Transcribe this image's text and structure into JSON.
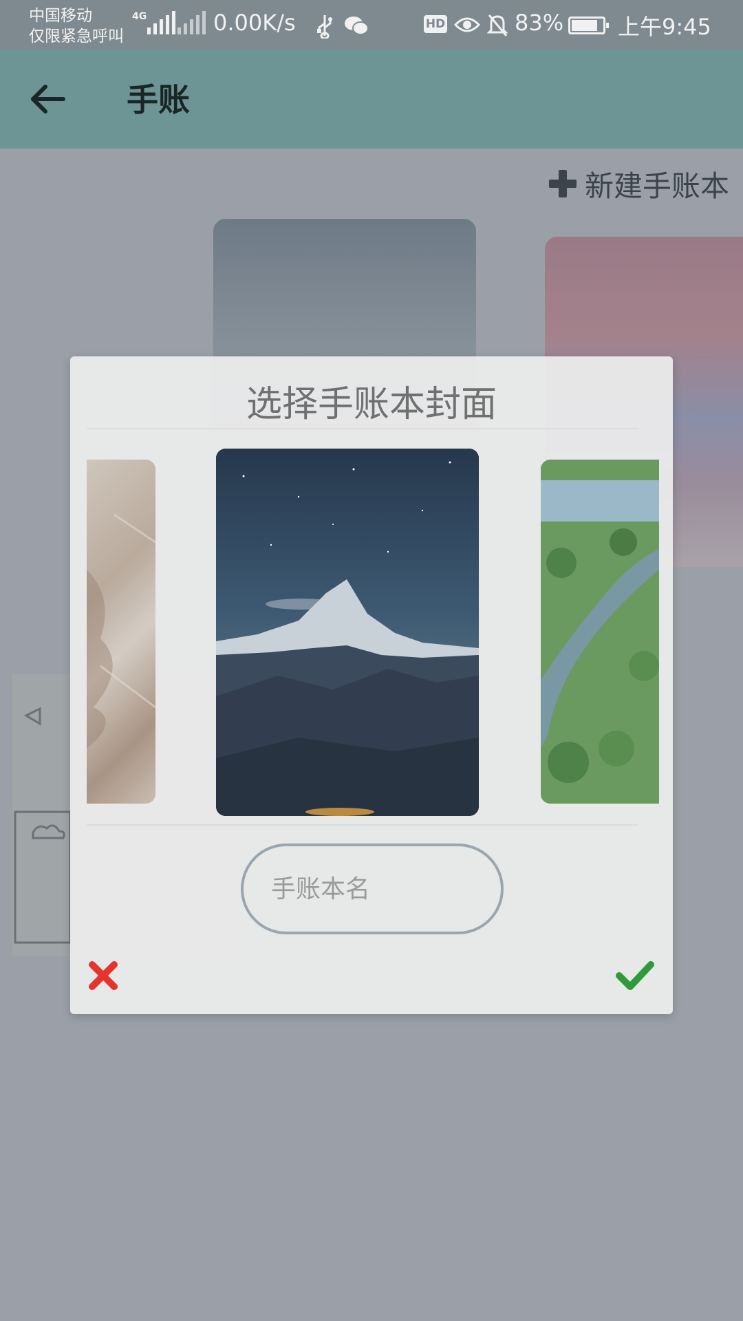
{
  "status_bar": {
    "carrier_line1": "中国移动",
    "carrier_line2": "仅限紧急呼叫",
    "network": "4G",
    "network_speed": "0.00K/s",
    "hd_badge": "HD",
    "battery_percent": "83%",
    "battery_level": 0.83,
    "time": "上午9:45",
    "icons": [
      "signal-icon",
      "no-signal-icon",
      "usb-icon",
      "wechat-icon",
      "eye-icon",
      "mute-bell-icon",
      "battery-icon"
    ]
  },
  "app_bar": {
    "title": "手账",
    "back_icon": "arrow-left-icon",
    "color": "#6d9596"
  },
  "page": {
    "new_journal_label": "新建手账本",
    "new_journal_icon": "plus-icon"
  },
  "dialog": {
    "title": "选择手账本封面",
    "name_placeholder": "手账本名",
    "name_value": "",
    "cancel_icon": "close-icon",
    "confirm_icon": "check-icon",
    "cancel_color": "#e8322d",
    "confirm_color": "#2f9a3a"
  }
}
